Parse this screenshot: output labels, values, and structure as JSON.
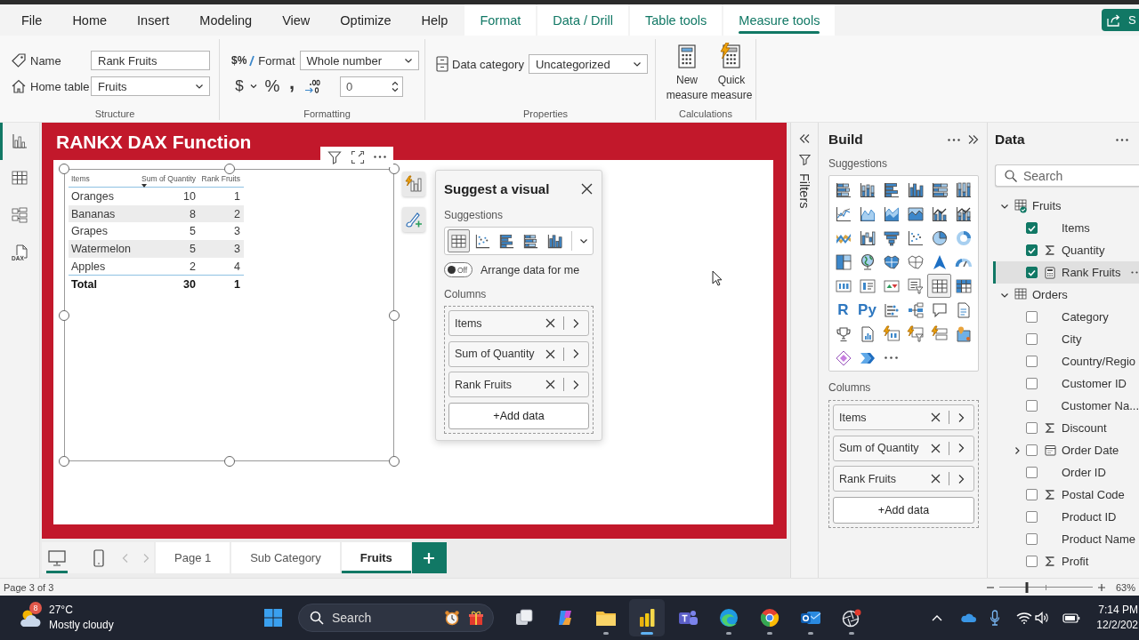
{
  "menu": {
    "tabs": [
      {
        "label": "File",
        "contextual": false,
        "selected": false
      },
      {
        "label": "Home",
        "contextual": false,
        "selected": false
      },
      {
        "label": "Insert",
        "contextual": false,
        "selected": false
      },
      {
        "label": "Modeling",
        "contextual": false,
        "selected": false
      },
      {
        "label": "View",
        "contextual": false,
        "selected": false
      },
      {
        "label": "Optimize",
        "contextual": false,
        "selected": false
      },
      {
        "label": "Help",
        "contextual": false,
        "selected": false
      },
      {
        "label": "Format",
        "contextual": true,
        "selected": false
      },
      {
        "label": "Data / Drill",
        "contextual": true,
        "selected": false
      },
      {
        "label": "Table tools",
        "contextual": true,
        "selected": false
      },
      {
        "label": "Measure tools",
        "contextual": true,
        "selected": true
      }
    ],
    "share": "S"
  },
  "ribbon": {
    "structure": {
      "title": "Structure",
      "name_label": "Name",
      "name_value": "Rank Fruits",
      "home_table_label": "Home table",
      "home_table_value": "Fruits"
    },
    "formatting": {
      "title": "Formatting",
      "format_glyph": "$%",
      "format_label": "Format",
      "format_value": "Whole number",
      "currency": "$",
      "percent": "%",
      "comma": ",",
      "decimals": "0"
    },
    "properties": {
      "title": "Properties",
      "data_category_label": "Data category",
      "data_category_value": "Uncategorized"
    },
    "calculations": {
      "title": "Calculations",
      "buttons": [
        {
          "kind": "new",
          "label": "New measure"
        },
        {
          "kind": "quick",
          "label": "Quick measure"
        }
      ]
    }
  },
  "views": [
    {
      "kind": "report",
      "selected": true
    },
    {
      "kind": "table",
      "selected": false
    },
    {
      "kind": "model",
      "selected": false
    },
    {
      "kind": "dax",
      "label": "DAX",
      "selected": false
    }
  ],
  "canvas": {
    "title": "RANKX DAX Function",
    "table": {
      "columns": [
        {
          "label": "Items",
          "sorted": false
        },
        {
          "label": "Sum of Quantity",
          "sorted": true
        },
        {
          "label": "Rank Fruits",
          "sorted": false
        }
      ],
      "rows": [
        [
          "Oranges",
          "10",
          "1"
        ],
        [
          "Bananas",
          "8",
          "2"
        ],
        [
          "Grapes",
          "5",
          "3"
        ],
        [
          "Watermelon",
          "5",
          "3"
        ],
        [
          "Apples",
          "2",
          "4"
        ]
      ],
      "total": [
        "Total",
        "30",
        "1"
      ]
    },
    "suggest_visual": {
      "title": "Suggest a visual",
      "suggestions_label": "Suggestions",
      "options": [
        {
          "kind": "table",
          "selected": true
        },
        {
          "kind": "scatter",
          "selected": false
        },
        {
          "kind": "clustered-bar",
          "selected": false
        },
        {
          "kind": "stacked-bar",
          "selected": false
        },
        {
          "kind": "clustered-column",
          "selected": false
        }
      ],
      "arrange": {
        "on": false,
        "state_label": "Off",
        "label": "Arrange data for me"
      },
      "columns_label": "Columns",
      "columns": [
        "Items",
        "Sum of Quantity",
        "Rank Fruits"
      ],
      "add_data": "+Add data"
    }
  },
  "page_bar": {
    "layouts": [
      {
        "kind": "desktop",
        "selected": true
      },
      {
        "kind": "mobile",
        "selected": false
      }
    ],
    "pages": [
      {
        "label": "Page 1",
        "selected": false
      },
      {
        "label": "Sub Category",
        "selected": false
      },
      {
        "label": "Fruits",
        "selected": true
      }
    ]
  },
  "filters": {
    "label": "Filters"
  },
  "build": {
    "title": "Build",
    "suggestions_label": "Suggestions",
    "gallery": [
      {
        "kind": "stacked-bar",
        "selected": false
      },
      {
        "kind": "stacked-column",
        "selected": false
      },
      {
        "kind": "clustered-bar",
        "selected": false
      },
      {
        "kind": "clustered-column",
        "selected": false
      },
      {
        "kind": "percent-bar",
        "selected": false
      },
      {
        "kind": "percent-column",
        "selected": false
      },
      {
        "kind": "line",
        "selected": false
      },
      {
        "kind": "area",
        "selected": false
      },
      {
        "kind": "stacked-area",
        "selected": false
      },
      {
        "kind": "percent-area",
        "selected": false
      },
      {
        "kind": "line-column",
        "selected": false
      },
      {
        "kind": "line-stacked-column",
        "selected": false
      },
      {
        "kind": "ribbon",
        "selected": false
      },
      {
        "kind": "waterfall",
        "selected": false
      },
      {
        "kind": "funnel",
        "selected": false
      },
      {
        "kind": "scatter",
        "selected": false
      },
      {
        "kind": "pie",
        "selected": false
      },
      {
        "kind": "donut",
        "selected": false
      },
      {
        "kind": "treemap",
        "selected": false
      },
      {
        "kind": "globe-map",
        "selected": false
      },
      {
        "kind": "filled-map",
        "selected": false
      },
      {
        "kind": "shape-map",
        "selected": false
      },
      {
        "kind": "arrow-map",
        "selected": false
      },
      {
        "kind": "gauge",
        "selected": false
      },
      {
        "kind": "card",
        "selected": false
      },
      {
        "kind": "multirow-card",
        "selected": false
      },
      {
        "kind": "kpi",
        "selected": false
      },
      {
        "kind": "slicer",
        "selected": false
      },
      {
        "kind": "table",
        "selected": true
      },
      {
        "kind": "matrix",
        "selected": false
      },
      {
        "kind": "r-script",
        "label": "R",
        "selected": false
      },
      {
        "kind": "python",
        "label": "Py",
        "selected": false
      },
      {
        "kind": "key-influencers",
        "selected": false
      },
      {
        "kind": "decomposition",
        "selected": false
      },
      {
        "kind": "qa",
        "selected": false
      },
      {
        "kind": "narrative",
        "selected": false
      },
      {
        "kind": "goals",
        "selected": false
      },
      {
        "kind": "paginated",
        "selected": false
      },
      {
        "kind": "card-new",
        "selected": false
      },
      {
        "kind": "slicer-new",
        "selected": false
      },
      {
        "kind": "button-slicer",
        "selected": false
      },
      {
        "kind": "pin-map",
        "selected": false
      },
      {
        "kind": "power-apps",
        "selected": false
      },
      {
        "kind": "power-automate",
        "selected": false
      },
      {
        "kind": "more",
        "selected": false
      }
    ],
    "columns_label": "Columns",
    "columns": [
      "Items",
      "Sum of Quantity",
      "Rank Fruits"
    ],
    "add_data": "+Add data"
  },
  "data": {
    "title": "Data",
    "search_placeholder": "Search",
    "tables": [
      {
        "name": "Fruits",
        "expanded": true,
        "in_use": true,
        "fields": [
          {
            "name": "Items",
            "kind": "text",
            "checked": true,
            "selected": false
          },
          {
            "name": "Quantity",
            "kind": "sum",
            "checked": true,
            "selected": false
          },
          {
            "name": "Rank Fruits",
            "kind": "measure",
            "checked": true,
            "selected": true
          }
        ]
      },
      {
        "name": "Orders",
        "expanded": true,
        "in_use": false,
        "fields": [
          {
            "name": "Category",
            "kind": "text",
            "checked": false,
            "selected": false
          },
          {
            "name": "City",
            "kind": "text",
            "checked": false,
            "selected": false
          },
          {
            "name": "Country/Regio",
            "kind": "text",
            "checked": false,
            "selected": false
          },
          {
            "name": "Customer ID",
            "kind": "text",
            "checked": false,
            "selected": false
          },
          {
            "name": "Customer Na...",
            "kind": "text",
            "checked": false,
            "selected": false
          },
          {
            "name": "Discount",
            "kind": "sum",
            "checked": false,
            "selected": false
          },
          {
            "name": "Order Date",
            "kind": "date",
            "checked": false,
            "selected": false
          },
          {
            "name": "Order ID",
            "kind": "text",
            "checked": false,
            "selected": false
          },
          {
            "name": "Postal Code",
            "kind": "sum",
            "checked": false,
            "selected": false
          },
          {
            "name": "Product ID",
            "kind": "text",
            "checked": false,
            "selected": false
          },
          {
            "name": "Product Name",
            "kind": "text",
            "checked": false,
            "selected": false
          },
          {
            "name": "Profit",
            "kind": "sum",
            "checked": false,
            "selected": false
          }
        ]
      }
    ]
  },
  "status": {
    "page_info": "Page 3 of 3",
    "zoom": {
      "level": 0.3,
      "label": "63%"
    }
  },
  "taskbar": {
    "weather": {
      "badge": "8",
      "temperature": "27°C",
      "condition": "Mostly cloudy"
    },
    "search_placeholder": "Search",
    "apps": [
      {
        "kind": "task-view",
        "running": false,
        "active": false
      },
      {
        "kind": "copilot",
        "running": false,
        "active": false
      },
      {
        "kind": "explorer",
        "running": true,
        "active": false
      },
      {
        "kind": "powerbi",
        "running": true,
        "active": true
      },
      {
        "kind": "teams",
        "running": false,
        "active": false
      },
      {
        "kind": "edge",
        "running": true,
        "active": false
      },
      {
        "kind": "chrome",
        "running": true,
        "active": false
      },
      {
        "kind": "outlook",
        "running": true,
        "active": false
      },
      {
        "kind": "recorder",
        "running": true,
        "active": false
      }
    ],
    "clock": {
      "time": "7:14 PM",
      "date": "12/2/202"
    }
  }
}
